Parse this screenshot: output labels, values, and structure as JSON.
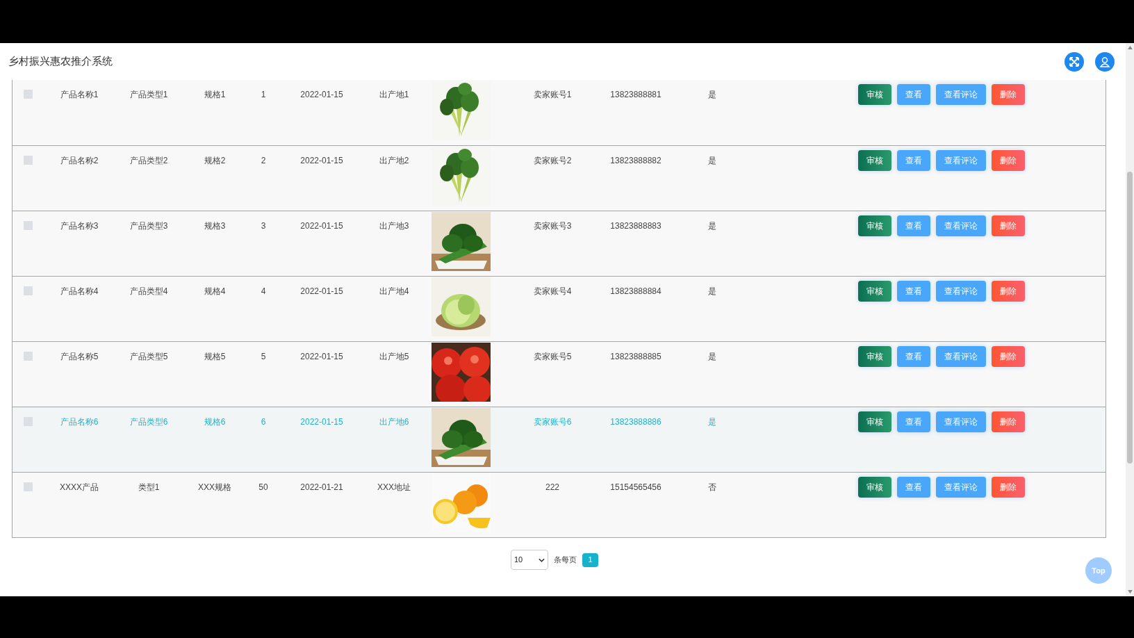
{
  "header": {
    "title": "乡村振兴惠农推介系统"
  },
  "rows": [
    {
      "checked": false,
      "hovered": false,
      "name": "产品名称1",
      "type": "产品类型1",
      "spec": "规格1",
      "quantity": "1",
      "date": "2022-01-15",
      "origin": "出产地1",
      "seller": "卖家账号1",
      "phone": "13823888881",
      "flag": "是",
      "actions": [
        "审核",
        "查看",
        "查看评论",
        "删除"
      ]
    },
    {
      "checked": false,
      "hovered": false,
      "name": "产品名称2",
      "type": "产品类型2",
      "spec": "规格2",
      "quantity": "2",
      "date": "2022-01-15",
      "origin": "出产地2",
      "seller": "卖家账号2",
      "phone": "13823888882",
      "flag": "是",
      "actions": [
        "审核",
        "查看",
        "查看评论",
        "删除"
      ]
    },
    {
      "checked": false,
      "hovered": false,
      "name": "产品名称3",
      "type": "产品类型3",
      "spec": "规格3",
      "quantity": "3",
      "date": "2022-01-15",
      "origin": "出产地3",
      "seller": "卖家账号3",
      "phone": "13823888883",
      "flag": "是",
      "actions": [
        "审核",
        "查看",
        "查看评论",
        "删除"
      ]
    },
    {
      "checked": false,
      "hovered": false,
      "name": "产品名称4",
      "type": "产品类型4",
      "spec": "规格4",
      "quantity": "4",
      "date": "2022-01-15",
      "origin": "出产地4",
      "seller": "卖家账号4",
      "phone": "13823888884",
      "flag": "是",
      "actions": [
        "审核",
        "查看",
        "查看评论",
        "删除"
      ]
    },
    {
      "checked": false,
      "hovered": false,
      "name": "产品名称5",
      "type": "产品类型5",
      "spec": "规格5",
      "quantity": "5",
      "date": "2022-01-15",
      "origin": "出产地5",
      "seller": "卖家账号5",
      "phone": "13823888885",
      "flag": "是",
      "actions": [
        "审核",
        "查看",
        "查看评论",
        "删除"
      ]
    },
    {
      "checked": false,
      "hovered": true,
      "name": "产品名称6",
      "type": "产品类型6",
      "spec": "规格6",
      "quantity": "6",
      "date": "2022-01-15",
      "origin": "出产地6",
      "seller": "卖家账号6",
      "phone": "13823888886",
      "flag": "是",
      "actions": [
        "审核",
        "查看",
        "查看评论",
        "删除"
      ]
    },
    {
      "checked": false,
      "hovered": false,
      "name": "XXXX产品",
      "type": "类型1",
      "spec": "XXX规格",
      "quantity": "50",
      "date": "2022-01-21",
      "origin": "XXX地址",
      "seller": "222",
      "phone": "15154565456",
      "flag": "否",
      "actions": [
        "审核",
        "查看",
        "查看评论",
        "删除"
      ]
    }
  ],
  "pagination": {
    "page_size": "10",
    "per_page_label": "条每页",
    "pages": [
      {
        "label": "1",
        "selected": true
      }
    ]
  },
  "top_button": "Top"
}
